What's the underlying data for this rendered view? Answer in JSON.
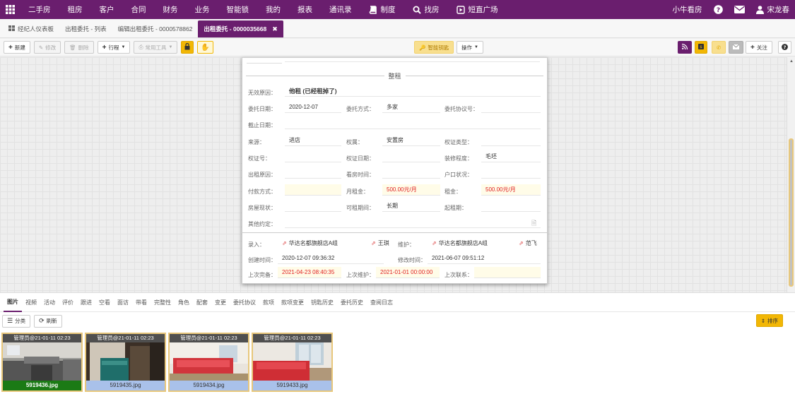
{
  "topnav": {
    "items": [
      {
        "label": "二手房"
      },
      {
        "label": "租房"
      },
      {
        "label": "客户"
      },
      {
        "label": "合同"
      },
      {
        "label": "财务"
      },
      {
        "label": "业务"
      },
      {
        "label": "智能锁"
      },
      {
        "label": "我的"
      },
      {
        "label": "报表"
      },
      {
        "label": "通讯录"
      },
      {
        "label": "制度",
        "icon": "book-icon"
      },
      {
        "label": "找房",
        "icon": "search-icon"
      },
      {
        "label": "短直广场",
        "icon": "video-icon"
      }
    ],
    "right": {
      "brand": "小牛看房",
      "user": "宋龙春"
    }
  },
  "tabs": [
    {
      "label": "经纪人仪表板"
    },
    {
      "label": "出租委托 - 列表"
    },
    {
      "label": "编辑出租委托 - 0000578862"
    },
    {
      "label": "出租委托 - 0000035668",
      "active": true
    }
  ],
  "toolbar": {
    "new": "新建",
    "edit": "修改",
    "delete": "删除",
    "schedule": "行程",
    "common_tools": "常用工具",
    "smart_key": "智能钥匙",
    "operate": "操作",
    "follow": "关注"
  },
  "form": {
    "section": "整租",
    "invalid_reason": {
      "label": "无效原因：",
      "value": "他租 (已经租掉了)"
    },
    "entrust_date": {
      "label": "委托日期：",
      "value": "2020-12-07"
    },
    "entrust_method": {
      "label": "委托方式：",
      "value": "多家"
    },
    "entrust_no": {
      "label": "委托协议号：",
      "value": ""
    },
    "deadline": {
      "label": "截止日期：",
      "value": ""
    },
    "source": {
      "label": "来源：",
      "value": "进店"
    },
    "ownership": {
      "label": "权属：",
      "value": "安置房"
    },
    "cert_type": {
      "label": "权证类型：",
      "value": ""
    },
    "cert_no": {
      "label": "权证号：",
      "value": ""
    },
    "cert_date": {
      "label": "权证日期：",
      "value": ""
    },
    "decoration": {
      "label": "装修程度：",
      "value": "毛坯"
    },
    "rent_reason": {
      "label": "出租原因：",
      "value": ""
    },
    "view_time": {
      "label": "看房时间：",
      "value": ""
    },
    "hukou": {
      "label": "户口状况：",
      "value": ""
    },
    "pay_method": {
      "label": "付款方式：",
      "value": ""
    },
    "monthly_rent": {
      "label": "月租金：",
      "value": "500.00元/月"
    },
    "rent": {
      "label": "租金：",
      "value": "500.00元/月"
    },
    "house_status": {
      "label": "房屋现状：",
      "value": ""
    },
    "rent_period": {
      "label": "可租期间：",
      "value": "长期"
    },
    "start_period": {
      "label": "起租期：",
      "value": ""
    },
    "other": {
      "label": "其他约定：",
      "value": ""
    },
    "entry": {
      "label": "录入：",
      "shop": "华达名都旗舰店A组",
      "person": "王琪"
    },
    "maintain": {
      "label": "维护：",
      "shop": "华达名都旗舰店A组",
      "person": "范飞"
    },
    "created": {
      "label": "创建时间：",
      "value": "2020-12-07 09:36:32"
    },
    "modified": {
      "label": "修改时间：",
      "value": "2021-06-07 09:51:12"
    },
    "last_complete": {
      "label": "上次完备：",
      "value": "2021-04-23 08:40:35"
    },
    "last_maintain": {
      "label": "上次维护：",
      "value": "2021-01-01 00:00:00"
    },
    "last_contact": {
      "label": "上次联系：",
      "value": ""
    }
  },
  "bottom_tabs": [
    "图片",
    "视频",
    "活动",
    "评价",
    "跟进",
    "空看",
    "面访",
    "带看",
    "完整性",
    "角色",
    "配套",
    "变更",
    "委托协议",
    "款项",
    "款项变更",
    "钥匙历史",
    "委托历史",
    "查阅日志"
  ],
  "bottom_bar": {
    "classify": "分类",
    "refresh": "刷新",
    "sort": "排序"
  },
  "photos": [
    {
      "caption": "管理员@21-01-11 02:23",
      "file": "5919436.jpg",
      "selected": true
    },
    {
      "caption": "管理员@21-01-11 02:23",
      "file": "5919435.jpg"
    },
    {
      "caption": "管理员@21-01-11 02:23",
      "file": "5919434.jpg"
    },
    {
      "caption": "管理员@21-01-11 02:23",
      "file": "5919433.jpg"
    }
  ],
  "colors": {
    "brand": "#6a1e6e",
    "accent": "#f2b705",
    "danger": "#e02020"
  }
}
